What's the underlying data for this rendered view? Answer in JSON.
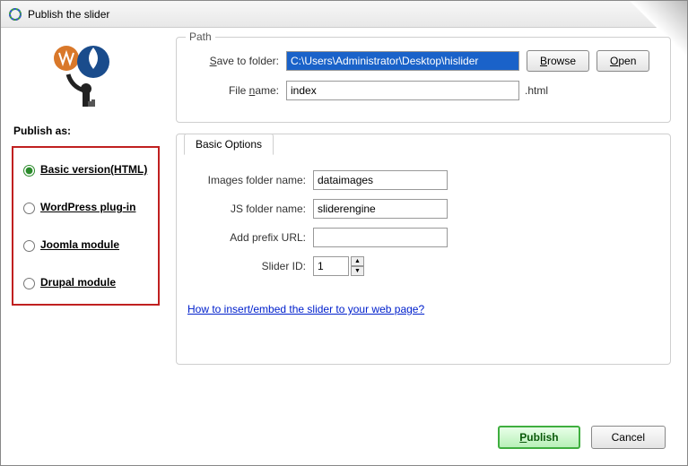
{
  "window": {
    "title": "Publish the slider"
  },
  "sidebar": {
    "publish_as": "Publish as:",
    "options": {
      "basic": "Basic version(HTML)",
      "wordpress": "WordPress plug-in",
      "joomla": "Joomla module",
      "drupal": "Drupal module"
    }
  },
  "path_group": {
    "legend": "Path",
    "save_to_folder_label": "Save to folder:",
    "save_to_folder_value": "C:\\Users\\Administrator\\Desktop\\hislider",
    "file_name_label": "File name:",
    "file_name_value": "index",
    "file_ext": ".html",
    "browse": "Browse",
    "open": "Open"
  },
  "basic_options": {
    "tab_label": "Basic Options",
    "images_folder_label": "Images folder name:",
    "images_folder_value": "dataimages",
    "js_folder_label": "JS folder name:",
    "js_folder_value": "sliderengine",
    "prefix_label": "Add prefix URL:",
    "prefix_value": "",
    "slider_id_label": "Slider ID:",
    "slider_id_value": "1",
    "help_link": "How to insert/embed the slider to your web page?"
  },
  "footer": {
    "publish": "Publish",
    "cancel": "Cancel"
  }
}
